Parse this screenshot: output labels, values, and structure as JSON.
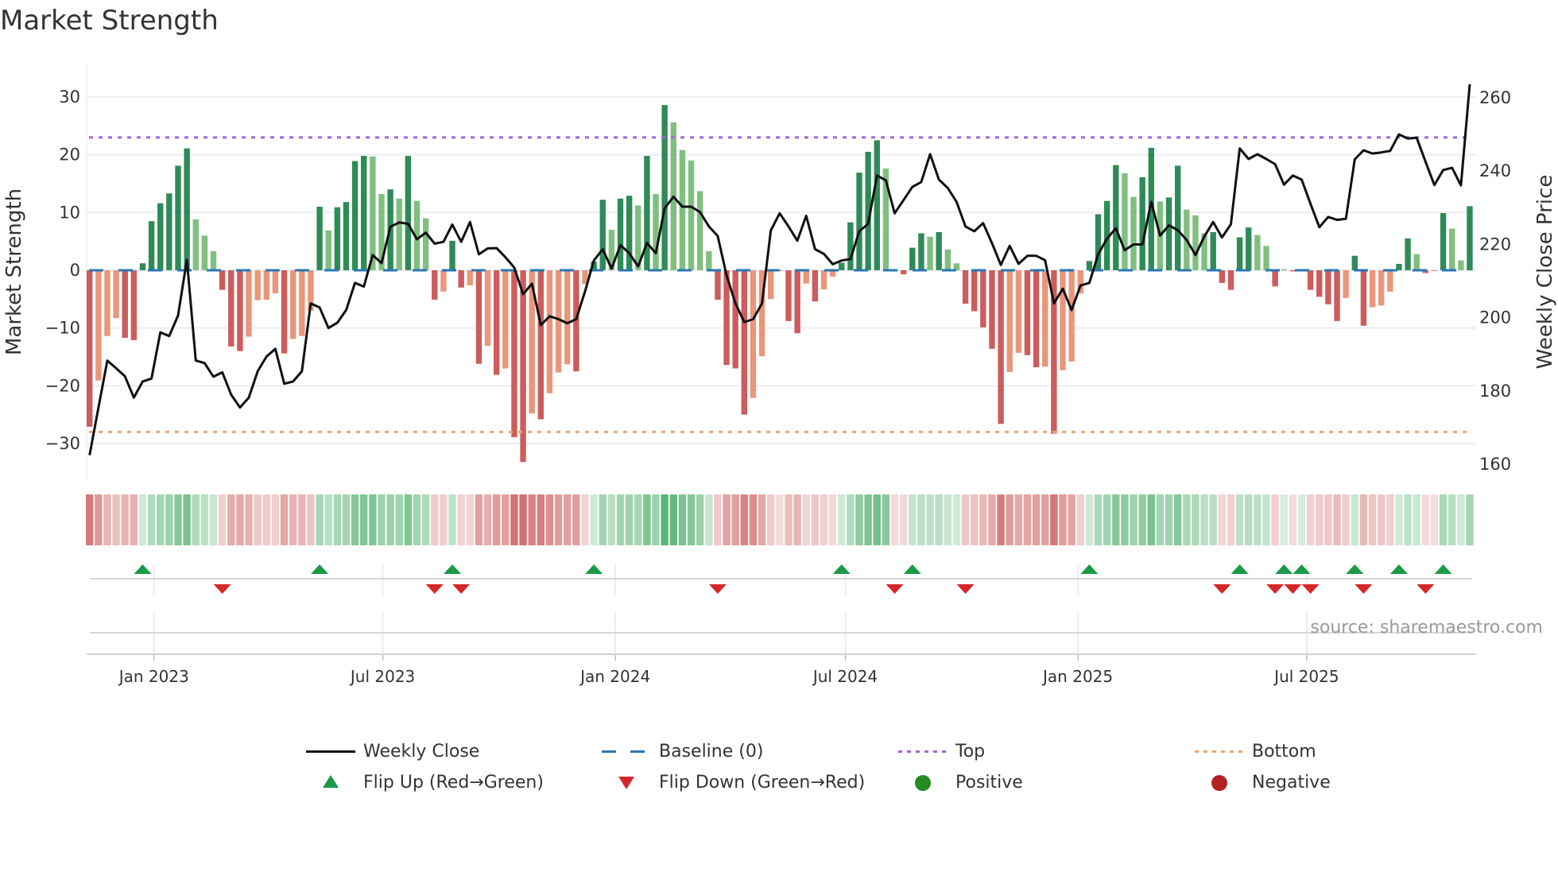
{
  "title": "Market Strength",
  "source_note": "source: sharemaestro.com",
  "colors": {
    "strong_green": "#2e8b57",
    "weak_green": "#7fbf7f",
    "strong_red": "#cd5c5c",
    "weak_red": "#e9967a",
    "close_line": "#111111",
    "baseline": "#2b77b3",
    "top": "#a066d9",
    "bottom": "#f2a56c",
    "flip_up": "#1a9a46",
    "flip_down": "#d62728",
    "positive": "#228b22",
    "negative": "#b22222",
    "heat_green": "#2ea050",
    "heat_red": "#c85050"
  },
  "chart_data": {
    "type": "bar+line",
    "ylabel_left": "Market Strength",
    "ylabel_right": "Weekly Close Price",
    "start_week": "2022-11-11",
    "interval_days": 7,
    "ylim_left": [
      -36.2,
      35.5
    ],
    "ylim_right": [
      155.9,
      268.9
    ],
    "left_ticks": [
      "30",
      "20",
      "10",
      "0",
      "−10",
      "−20",
      "−30"
    ],
    "left_tick_values": [
      30,
      20,
      10,
      0,
      -10,
      -20,
      -30
    ],
    "right_ticks": [
      "260",
      "240",
      "220",
      "200",
      "180",
      "160"
    ],
    "right_tick_values": [
      260,
      240,
      220,
      200,
      180,
      160
    ],
    "x_ticks": [
      {
        "label": "Jan 2023",
        "date": "2023-01-01"
      },
      {
        "label": "Jul 2023",
        "date": "2023-07-01"
      },
      {
        "label": "Jan 2024",
        "date": "2024-01-01"
      },
      {
        "label": "Jul 2024",
        "date": "2024-07-01"
      },
      {
        "label": "Jan 2025",
        "date": "2025-01-01"
      },
      {
        "label": "Jul 2025",
        "date": "2025-07-01"
      }
    ],
    "top": 23,
    "bottom": -28,
    "baseline": 0,
    "strength": [
      -27.1,
      -19.1,
      -11.4,
      -8.3,
      -11.7,
      -12.1,
      1.2,
      8.5,
      11.6,
      13.3,
      18.1,
      21.1,
      8.8,
      6.0,
      3.3,
      -3.4,
      -13.2,
      -14.0,
      -11.5,
      -5.2,
      -5.1,
      -4.0,
      -14.4,
      -11.9,
      -11.4,
      -7.0,
      11.0,
      6.9,
      10.9,
      11.8,
      18.9,
      19.8,
      19.7,
      13.2,
      14.0,
      12.4,
      19.8,
      12.0,
      9.0,
      -5.1,
      -3.7,
      5.1,
      -3.0,
      -2.6,
      -16.2,
      -13.1,
      -18.1,
      -17.0,
      -28.9,
      -33.2,
      -24.8,
      -25.8,
      -21.3,
      -17.7,
      -16.3,
      -17.5,
      -2.4,
      1.5,
      12.2,
      7.0,
      12.4,
      12.9,
      11.2,
      19.8,
      13.2,
      28.6,
      25.6,
      20.8,
      19.0,
      13.7,
      3.3,
      -5.1,
      -16.4,
      -17.0,
      -25.0,
      -22.1,
      -14.9,
      -5.0,
      -0.1,
      -8.8,
      -10.9,
      -2.3,
      -5.4,
      -3.3,
      -1.1,
      1.3,
      8.3,
      16.9,
      20.5,
      22.5,
      17.6,
      -0.2,
      -0.7,
      3.9,
      6.4,
      5.8,
      6.6,
      3.6,
      1.2,
      -5.8,
      -7.1,
      -9.9,
      -13.6,
      -26.6,
      -17.6,
      -14.3,
      -14.7,
      -16.8,
      -16.7,
      -28.3,
      -17.3,
      -15.8,
      -4.0,
      1.6,
      9.7,
      12.0,
      18.2,
      16.8,
      12.7,
      16.1,
      21.2,
      11.9,
      12.6,
      18.1,
      10.5,
      9.5,
      6.4,
      6.6,
      -2.2,
      -3.4,
      5.7,
      7.4,
      6.1,
      4.2,
      -2.8,
      0.2,
      -0.2,
      0.1,
      -3.4,
      -4.6,
      -5.9,
      -8.8,
      -4.8,
      2.5,
      -9.6,
      -6.4,
      -6.1,
      -3.7,
      1.1,
      5.5,
      2.8,
      -0.5,
      -0.1,
      9.9,
      7.2,
      1.7,
      11.1
    ],
    "shade": "dlllddddddddlllddd",
    "shade_full": [
      "d",
      "l",
      "l",
      "l",
      "d",
      "d",
      "d",
      "d",
      "d",
      "d",
      "d",
      "d",
      "l",
      "l",
      "l",
      "d",
      "d",
      "d",
      "l",
      "l",
      "l",
      "l",
      "d",
      "l",
      "l",
      "l",
      "d",
      "l",
      "d",
      "d",
      "d",
      "d",
      "l",
      "l",
      "d",
      "l",
      "d",
      "l",
      "l",
      "d",
      "l",
      "d",
      "d",
      "l",
      "d",
      "l",
      "d",
      "l",
      "d",
      "d",
      "l",
      "d",
      "l",
      "l",
      "l",
      "d",
      "l",
      "d",
      "d",
      "l",
      "d",
      "d",
      "l",
      "d",
      "l",
      "d",
      "l",
      "l",
      "l",
      "l",
      "l",
      "d",
      "d",
      "d",
      "d",
      "l",
      "l",
      "l",
      "d",
      "d",
      "d",
      "l",
      "d",
      "l",
      "l",
      "d",
      "d",
      "d",
      "d",
      "d",
      "l",
      "d",
      "d",
      "d",
      "d",
      "l",
      "d",
      "l",
      "l",
      "d",
      "d",
      "d",
      "d",
      "d",
      "l",
      "l",
      "d",
      "d",
      "l",
      "d",
      "l",
      "l",
      "l",
      "d",
      "d",
      "d",
      "d",
      "l",
      "l",
      "d",
      "d",
      "l",
      "d",
      "d",
      "l",
      "l",
      "l",
      "d",
      "d",
      "d",
      "d",
      "d",
      "l",
      "l",
      "d",
      "l",
      "d",
      "d",
      "d",
      "d",
      "d",
      "d",
      "l",
      "d",
      "d",
      "l",
      "l",
      "l",
      "d",
      "d",
      "l",
      "d",
      "d",
      "d",
      "l",
      "l",
      "d"
    ],
    "close": [
      162.5,
      175.4,
      188.3,
      186.2,
      184,
      178.2,
      182.6,
      183.4,
      196,
      195,
      200.6,
      215.8,
      188.3,
      187.6,
      183.9,
      185.1,
      179,
      175.5,
      178.2,
      185.4,
      189.4,
      191.5,
      182,
      182.6,
      185.4,
      203.9,
      202.8,
      197.2,
      198.6,
      202.1,
      209.5,
      208.5,
      217.1,
      214.9,
      224.8,
      226,
      225.6,
      221.4,
      223.2,
      220.2,
      220.7,
      225.4,
      220.7,
      226.1,
      217.3,
      218.9,
      219,
      216.5,
      213.7,
      206.4,
      209.3,
      198,
      200.4,
      199.6,
      198.5,
      199.6,
      207.2,
      215.6,
      218.7,
      213.4,
      219.8,
      217.6,
      214,
      220.4,
      217.6,
      229.9,
      233,
      230.3,
      230.3,
      228.8,
      224.9,
      222.3,
      211.5,
      203.9,
      198.8,
      199.6,
      203.9,
      223.8,
      228.5,
      224.9,
      221,
      227.8,
      218.7,
      217.4,
      214.6,
      215.6,
      216,
      223.6,
      225.6,
      238.8,
      237.5,
      228.5,
      232.1,
      235.7,
      237,
      244.6,
      237.7,
      235.4,
      231.6,
      224.9,
      223.6,
      225.8,
      220.3,
      214.4,
      219.6,
      214.7,
      216.9,
      216.9,
      215.7,
      203.9,
      207.9,
      202.1,
      208.8,
      209.5,
      217.3,
      221.6,
      224.4,
      218.4,
      220,
      220,
      231.6,
      222.4,
      225.2,
      223.9,
      221.2,
      217.1,
      222.2,
      226.1,
      221.9,
      225.5,
      246.2,
      243.3,
      244.6,
      243.3,
      241.9,
      236.3,
      238.8,
      237.7,
      231.1,
      224.7,
      227.5,
      226.7,
      227,
      243.2,
      245.7,
      244.8,
      245.1,
      245.5,
      250,
      248.9,
      249.1,
      242.6,
      236.2,
      240.3,
      240.9,
      236.1,
      263.7
    ],
    "flip_up_weeks": [
      7,
      27,
      42,
      58,
      86,
      94,
      114,
      131,
      136,
      138,
      144,
      149,
      154
    ],
    "flip_down_weeks": [
      16,
      40,
      43,
      72,
      92,
      100,
      129,
      135,
      137,
      139,
      145,
      152
    ]
  },
  "legend": {
    "weekly_close": "Weekly Close",
    "baseline": "Baseline (0)",
    "top": "Top",
    "bottom": "Bottom",
    "flip_up": "Flip Up (Red→Green)",
    "flip_down": "Flip Down (Green→Red)",
    "positive": "Positive",
    "negative": "Negative"
  }
}
